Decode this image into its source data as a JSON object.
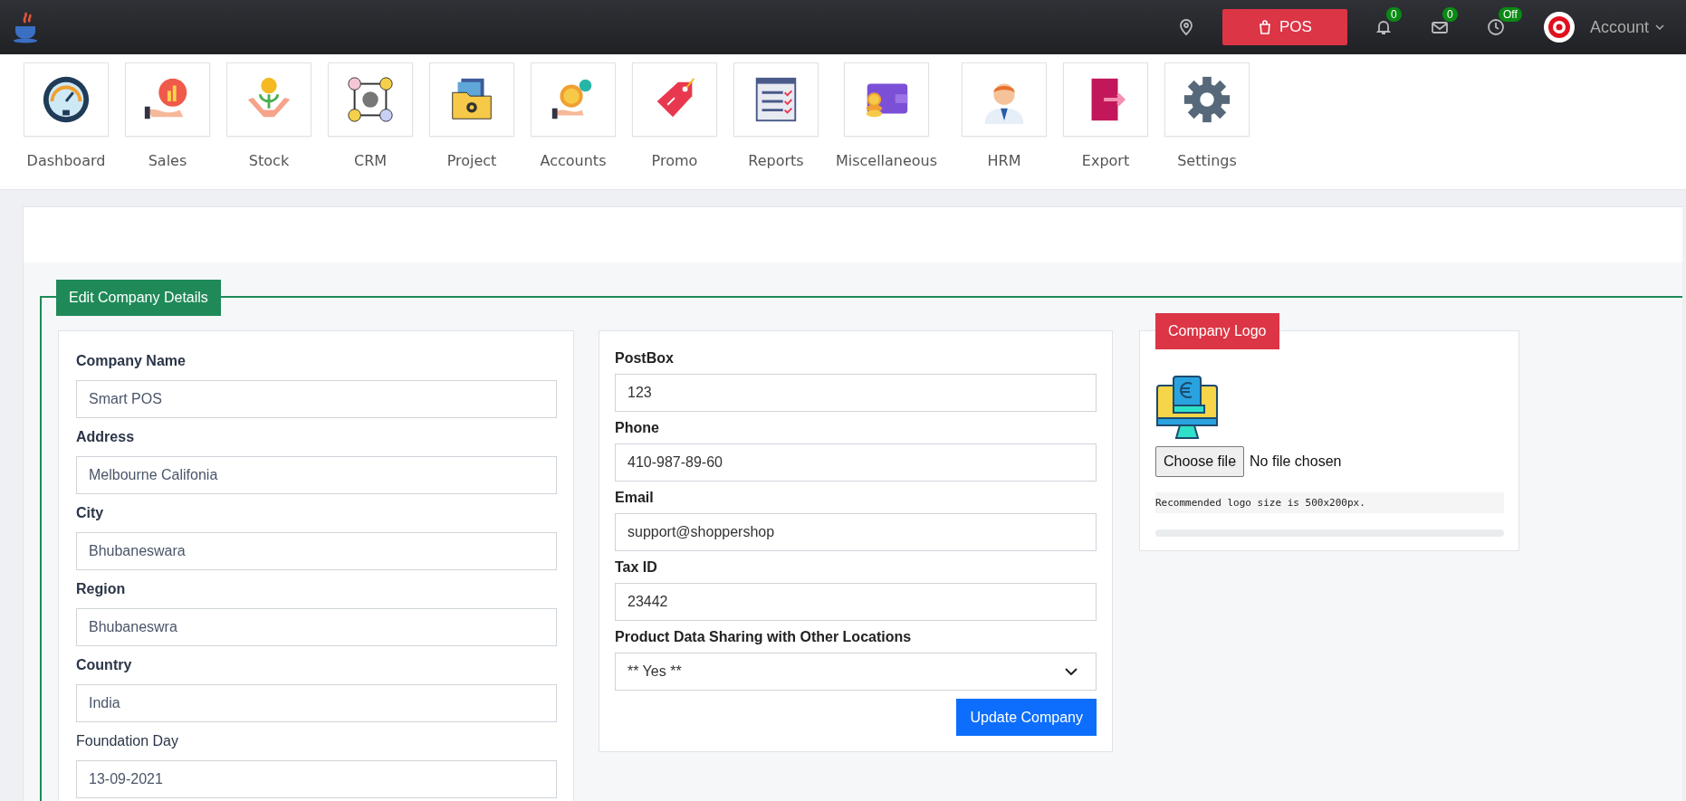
{
  "topbar": {
    "pos_button": "POS",
    "notifications": [
      {
        "badge": "0"
      },
      {
        "badge": "0"
      },
      {
        "badge": "Off"
      }
    ],
    "account": "Account"
  },
  "modules": [
    {
      "label": "Dashboard"
    },
    {
      "label": "Sales"
    },
    {
      "label": "Stock"
    },
    {
      "label": "CRM"
    },
    {
      "label": "Project"
    },
    {
      "label": "Accounts"
    },
    {
      "label": "Promo"
    },
    {
      "label": "Reports"
    },
    {
      "label": "Miscellaneous"
    },
    {
      "label": "HRM"
    },
    {
      "label": "Export"
    },
    {
      "label": "Settings"
    }
  ],
  "form": {
    "legend": "Edit Company Details",
    "left_fields": [
      {
        "label": "Company Name",
        "value": "Smart POS",
        "bold": true
      },
      {
        "label": "Address",
        "value": "Melbourne Califonia",
        "bold": true
      },
      {
        "label": "City",
        "value": "Bhubaneswara",
        "bold": true
      },
      {
        "label": "Region",
        "value": "Bhubaneswra",
        "bold": true
      },
      {
        "label": "Country",
        "value": "India",
        "bold": true
      },
      {
        "label": "Foundation Day",
        "value": "13-09-2021",
        "bold": false
      }
    ],
    "middle_fields": [
      {
        "label": "PostBox",
        "value": "123",
        "kind": "input"
      },
      {
        "label": "Phone",
        "value": "410-987-89-60",
        "kind": "input"
      },
      {
        "label": "Email",
        "value": "support@shoppershop",
        "kind": "input"
      },
      {
        "label": "Tax ID",
        "value": "23442",
        "kind": "input"
      },
      {
        "label": "Product Data Sharing with Other Locations",
        "value": "** Yes **",
        "kind": "select"
      }
    ],
    "submit": "Update Company"
  },
  "logo": {
    "legend": "Company Logo",
    "choose_button": "Choose file",
    "file_status": "No file chosen",
    "hint": "Recommended logo size is 500x200px."
  }
}
